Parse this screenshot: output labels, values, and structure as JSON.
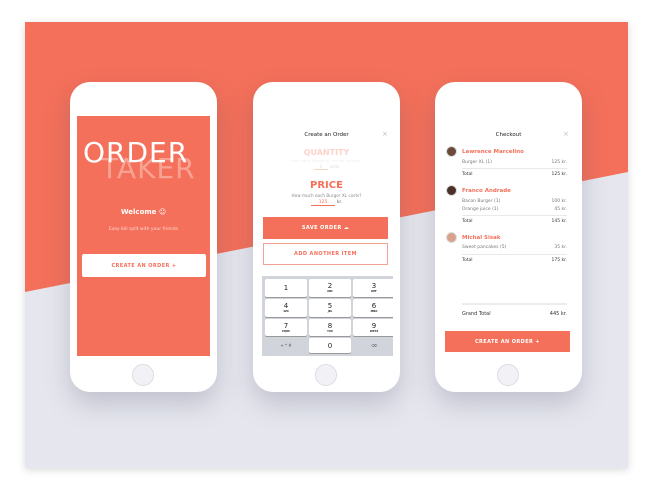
{
  "welcome_screen": {
    "logo_line1": "ORDER",
    "logo_line2": "TAKER",
    "welcome": "Welcome ☺",
    "subtitle": "Easy bill split with your friends",
    "create_button": "CREATE AN ORDER  +"
  },
  "create_screen": {
    "title": "Create an Order",
    "close": "×",
    "quantity": {
      "label": "QUANTITY",
      "question": "How many Burger XL will be ordered?",
      "value": "1",
      "unit": "units"
    },
    "price": {
      "label": "PRICE",
      "question": "How much each Burger XL costs?",
      "value": "125",
      "unit": "kr."
    },
    "save_button": "SAVE ORDER ☁",
    "add_button": "ADD ANOTHER ITEM",
    "keypad": [
      {
        "d": "1",
        "l": ""
      },
      {
        "d": "2",
        "l": "ABC"
      },
      {
        "d": "3",
        "l": "DEF"
      },
      {
        "d": "4",
        "l": "GHI"
      },
      {
        "d": "5",
        "l": "JKL"
      },
      {
        "d": "6",
        "l": "MNO"
      },
      {
        "d": "7",
        "l": "PQRS"
      },
      {
        "d": "8",
        "l": "TUV"
      },
      {
        "d": "9",
        "l": "WXYZ"
      },
      {
        "d": "+ * #",
        "l": ""
      },
      {
        "d": "0",
        "l": ""
      },
      {
        "d": "⌫",
        "l": ""
      }
    ]
  },
  "checkout_screen": {
    "title": "Checkout",
    "close": "×",
    "people": [
      {
        "name": "Lawrence Marcelino",
        "items": [
          {
            "name": "Burger XL (1)",
            "price": "125 kr."
          }
        ],
        "total_label": "Total",
        "total": "125 kr."
      },
      {
        "name": "Franco Andrade",
        "items": [
          {
            "name": "Bacon Burger (1)",
            "price": "100 kr."
          },
          {
            "name": "Orange juice (1)",
            "price": "45 kr."
          }
        ],
        "total_label": "Total",
        "total": "145 kr."
      },
      {
        "name": "Michal Sisak",
        "items": [
          {
            "name": "Sweet pancakes (5)",
            "price": "35 kr."
          }
        ],
        "total_label": "Total",
        "total": "175 kr."
      }
    ],
    "grand_total_label": "Grand Total",
    "grand_total": "445 kr.",
    "create_button": "CREATE AN ORDER  +"
  },
  "colors": {
    "accent": "#f4705a",
    "background": "#e6e7ee"
  }
}
